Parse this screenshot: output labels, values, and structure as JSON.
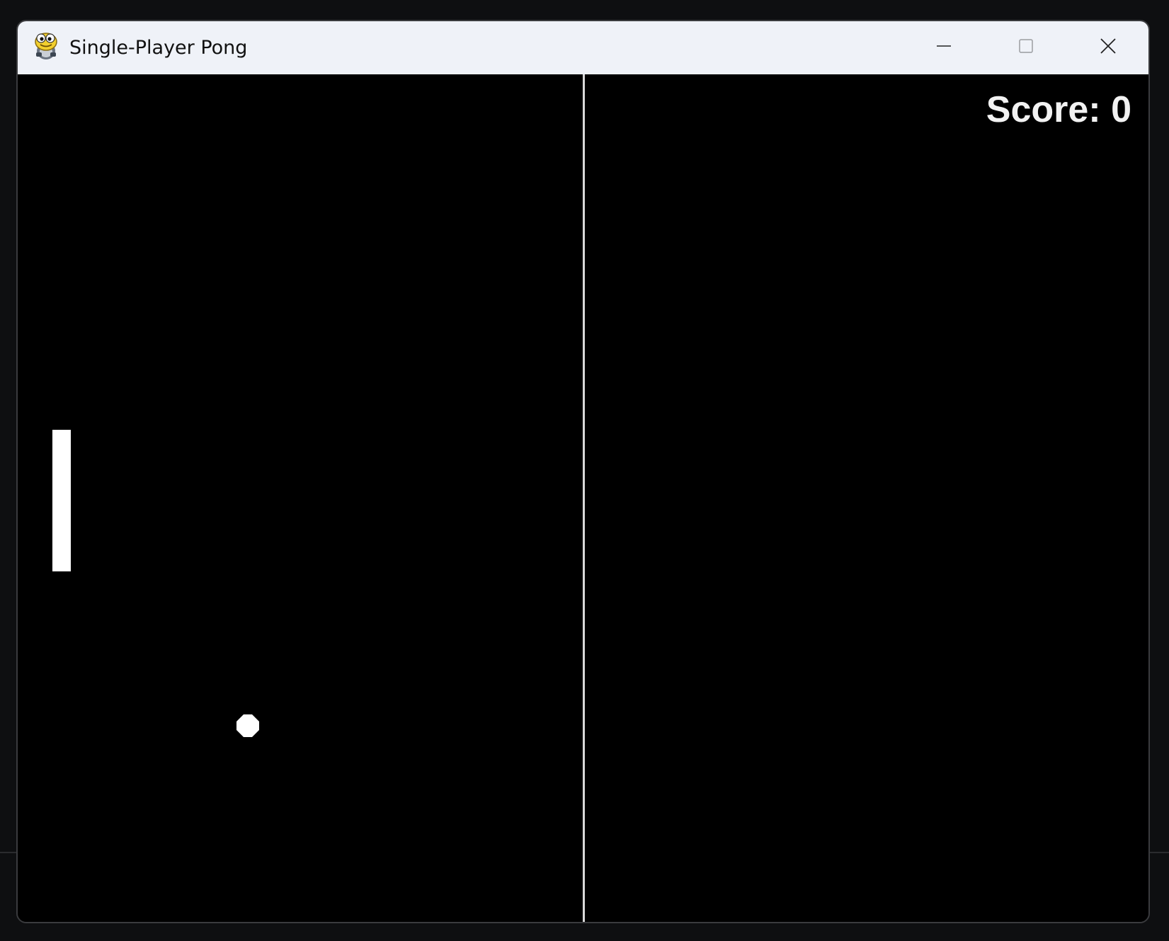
{
  "window": {
    "title": "Single-Player Pong",
    "app_icon": "pygame-snake-icon",
    "controls": {
      "minimize_icon": "minimize-icon",
      "maximize_icon": "maximize-icon",
      "close_icon": "close-icon"
    }
  },
  "game": {
    "score_text": "Score: 0",
    "background_color": "#000000",
    "foreground_color": "#ffffff"
  }
}
